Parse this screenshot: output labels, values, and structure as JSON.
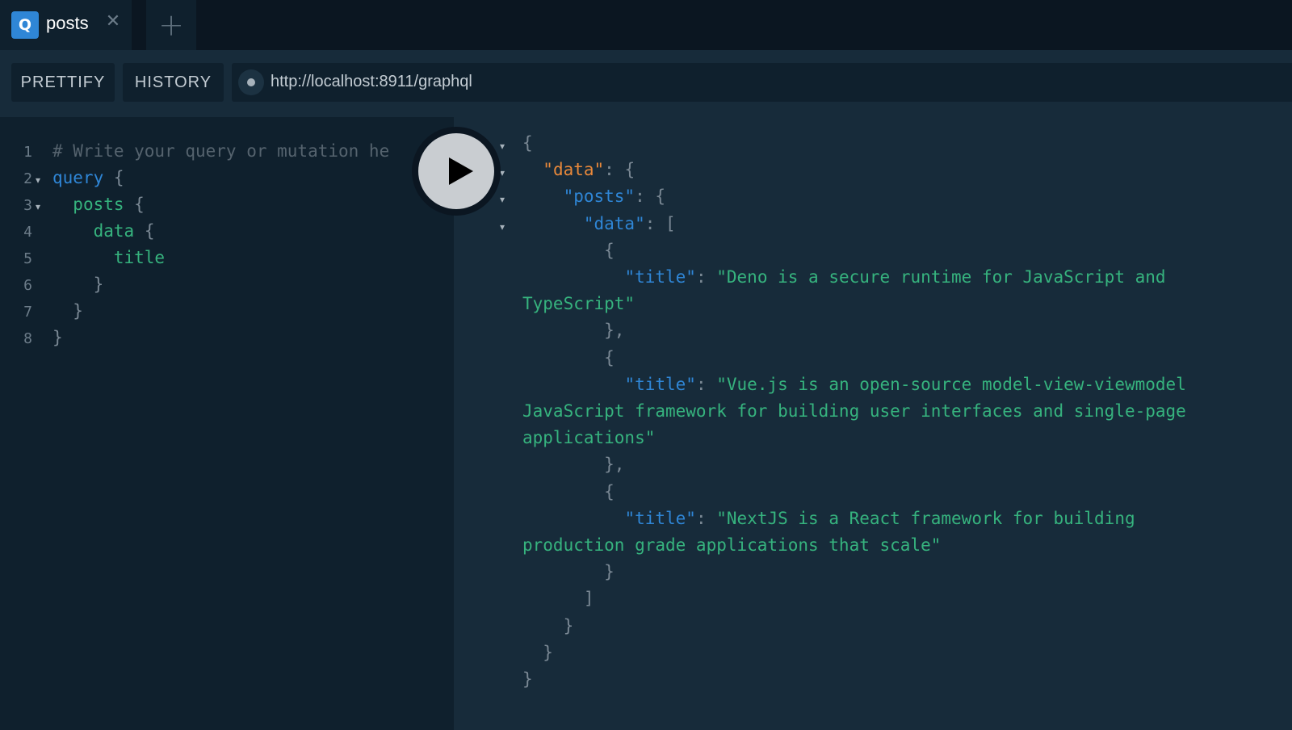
{
  "tabs": [
    {
      "badge": "Q",
      "title": "posts",
      "close": "✕"
    }
  ],
  "add_tab": "+",
  "toolbar": {
    "prettify": "PRETTIFY",
    "history": "HISTORY",
    "endpoint": "http://localhost:8911/graphql"
  },
  "editor": {
    "lines": [
      {
        "num": "1",
        "text": "# Write your query or mutation he",
        "kind": "comment"
      },
      {
        "num": "2",
        "text": "query {",
        "kind": "keyword"
      },
      {
        "num": "3",
        "text": "  posts {",
        "kind": "field"
      },
      {
        "num": "4",
        "text": "    data {",
        "kind": "field"
      },
      {
        "num": "5",
        "text": "      title",
        "kind": "field"
      },
      {
        "num": "6",
        "text": "    }",
        "kind": "punct"
      },
      {
        "num": "7",
        "text": "  }",
        "kind": "punct"
      },
      {
        "num": "8",
        "text": "}",
        "kind": "punct"
      }
    ]
  },
  "result": {
    "lines": [
      "{",
      "  \"data\": {",
      "    \"posts\": {",
      "      \"data\": [",
      "        {",
      "          \"title\": \"Deno is a secure runtime for JavaScript and",
      "TypeScript\"",
      "        },",
      "        {",
      "          \"title\": \"Vue.js is an open-source model-view-viewmodel",
      "JavaScript framework for building user interfaces and single-page",
      "applications\"",
      "        },",
      "        {",
      "          \"title\": \"NextJS is a React framework for building",
      "production grade applications that scale\"",
      "        }",
      "      ]",
      "    }",
      "  }",
      "}"
    ]
  },
  "icons": {
    "run": "play-icon",
    "fold": "▾"
  }
}
